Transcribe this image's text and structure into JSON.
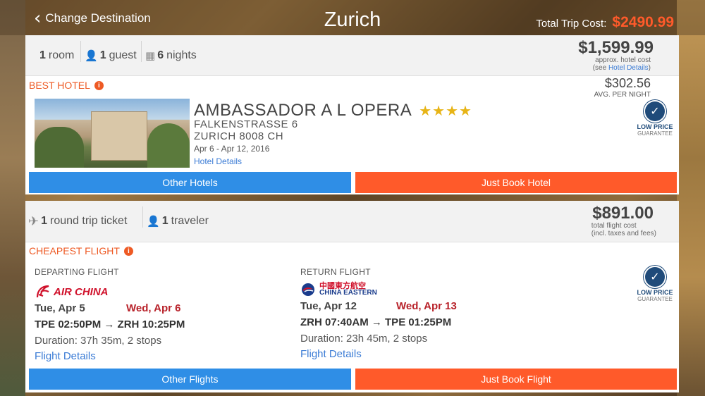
{
  "header": {
    "back_label": "Change Destination",
    "city": "Zurich",
    "total_label": "Total Trip Cost:",
    "total_value": "$2490.99"
  },
  "hotel": {
    "rooms_count": "1",
    "rooms_label": "room",
    "guests_count": "1",
    "guests_label": "guest",
    "nights_count": "6",
    "nights_label": "nights",
    "cost": "$1,599.99",
    "cost_note": "approx. hotel cost",
    "cost_note2_prefix": "(see ",
    "cost_note2_link": "Hotel Details",
    "cost_note2_suffix": ")",
    "badge": "BEST HOTEL",
    "name": "AMBASSADOR A L OPERA",
    "stars": "★★★★",
    "address_line1": "FALKENSTRASSE 6",
    "address_line2": "ZURICH 8008 CH",
    "dates": "Apr 6 - Apr 12, 2016",
    "details_link": "Hotel Details",
    "per_night_price": "$302.56",
    "per_night_label": "AVG. PER NIGHT",
    "guarantee_line1": "LOW PRICE",
    "guarantee_line2": "GUARANTEE",
    "other_button": "Other Hotels",
    "book_button": "Just Book Hotel"
  },
  "flight": {
    "tickets_count": "1",
    "tickets_label": "round trip ticket",
    "travelers_count": "1",
    "travelers_label": "traveler",
    "cost": "$891.00",
    "cost_note": "total flight cost",
    "cost_note2": "(incl. taxes and fees)",
    "badge": "CHEAPEST FLIGHT",
    "guarantee_line1": "LOW PRICE",
    "guarantee_line2": "GUARANTEE",
    "departing": {
      "label": "DEPARTING FLIGHT",
      "airline": "AIR CHINA",
      "date_from": "Tue, Apr 5",
      "date_to": "Wed, Apr 6",
      "route": "TPE 02:50PM → ZRH 10:25PM",
      "duration": "Duration: 37h 35m, 2 stops",
      "details_link": "Flight Details"
    },
    "return": {
      "label": "RETURN FLIGHT",
      "airline_cn": "中國東方航空",
      "airline": "CHINA EASTERN",
      "date_from": "Tue, Apr 12",
      "date_to": "Wed, Apr 13",
      "route": "ZRH 07:40AM → TPE 01:25PM",
      "duration": "Duration: 23h 45m, 2 stops",
      "details_link": "Flight Details"
    },
    "other_button": "Other Flights",
    "book_button": "Just Book Flight"
  },
  "colors": {
    "accent_orange": "#ff5a2a",
    "button_blue": "#2f8ee6",
    "badge_orange": "#ee5a24",
    "link_blue": "#3a7bd5",
    "star_gold": "#e7b416",
    "arrival_red": "#b8222a"
  },
  "icons": {
    "back": "chevron-left-icon",
    "guest": "person-icon",
    "nights": "calendar-icon",
    "plane": "plane-icon",
    "info": "info-icon",
    "guarantee": "check-seal-icon"
  }
}
